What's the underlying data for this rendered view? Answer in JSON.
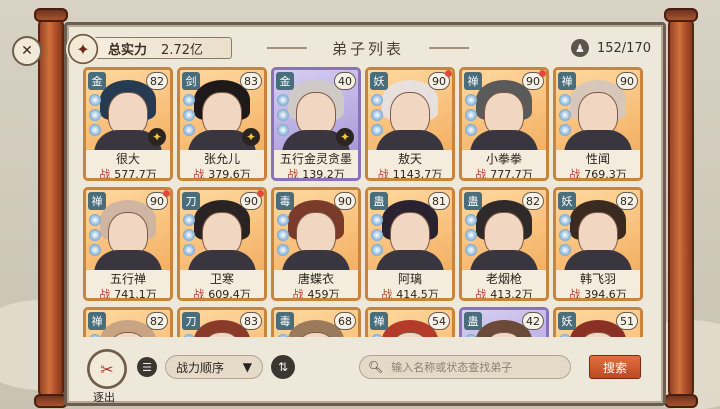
{
  "header": {
    "power_label": "总实力",
    "power_value": "2.72亿",
    "title": "弟子列表",
    "count": "152/170"
  },
  "stat_prefix": "战",
  "disciples": [
    {
      "name": "很大",
      "power": "577.7万",
      "level": "82",
      "sect": "金",
      "frame": "orange",
      "star": true,
      "dot": false
    },
    {
      "name": "张允儿",
      "power": "379.6万",
      "level": "83",
      "sect": "剑",
      "frame": "orange",
      "star": true,
      "dot": false
    },
    {
      "name": "五行金灵贪墨",
      "power": "139.2万",
      "level": "40",
      "sect": "金",
      "frame": "purple",
      "star": true,
      "dot": false
    },
    {
      "name": "敖天",
      "power": "1143.7万",
      "level": "90",
      "sect": "妖",
      "frame": "orange",
      "star": false,
      "dot": true
    },
    {
      "name": "小拳拳",
      "power": "777.7万",
      "level": "90",
      "sect": "禅",
      "frame": "orange",
      "star": false,
      "dot": true
    },
    {
      "name": "性闻",
      "power": "769.3万",
      "level": "90",
      "sect": "禅",
      "frame": "orange",
      "star": false,
      "dot": false
    },
    {
      "name": "五行禅",
      "power": "741.1万",
      "level": "90",
      "sect": "禅",
      "frame": "orange",
      "star": false,
      "dot": true
    },
    {
      "name": "卫寒",
      "power": "609.4万",
      "level": "90",
      "sect": "刀",
      "frame": "orange",
      "star": false,
      "dot": true
    },
    {
      "name": "唐蝶衣",
      "power": "459万",
      "level": "90",
      "sect": "毒",
      "frame": "orange",
      "star": false,
      "dot": false
    },
    {
      "name": "阿璃",
      "power": "414.5万",
      "level": "81",
      "sect": "蛊",
      "frame": "orange",
      "star": false,
      "dot": false
    },
    {
      "name": "老烟枪",
      "power": "413.2万",
      "level": "82",
      "sect": "蛊",
      "frame": "orange",
      "star": false,
      "dot": false
    },
    {
      "name": "韩飞羽",
      "power": "394.6万",
      "level": "82",
      "sect": "妖",
      "frame": "orange",
      "star": false,
      "dot": false
    },
    {
      "name": "",
      "power": "",
      "level": "82",
      "sect": "禅",
      "frame": "orange",
      "star": false,
      "dot": false
    },
    {
      "name": "",
      "power": "",
      "level": "83",
      "sect": "刀",
      "frame": "orange",
      "star": false,
      "dot": false
    },
    {
      "name": "",
      "power": "",
      "level": "68",
      "sect": "毒",
      "frame": "orange",
      "star": false,
      "dot": false
    },
    {
      "name": "",
      "power": "",
      "level": "54",
      "sect": "禅",
      "frame": "orange",
      "star": false,
      "dot": false
    },
    {
      "name": "",
      "power": "",
      "level": "42",
      "sect": "蛊",
      "frame": "purple",
      "star": false,
      "dot": false
    },
    {
      "name": "",
      "power": "",
      "level": "51",
      "sect": "妖",
      "frame": "orange",
      "star": false,
      "dot": false
    }
  ],
  "bottom": {
    "retreat_label": "逐出",
    "sort_label": "战力顺序",
    "search_placeholder": "输入名称或状态查找弟子",
    "search_button": "搜索"
  }
}
